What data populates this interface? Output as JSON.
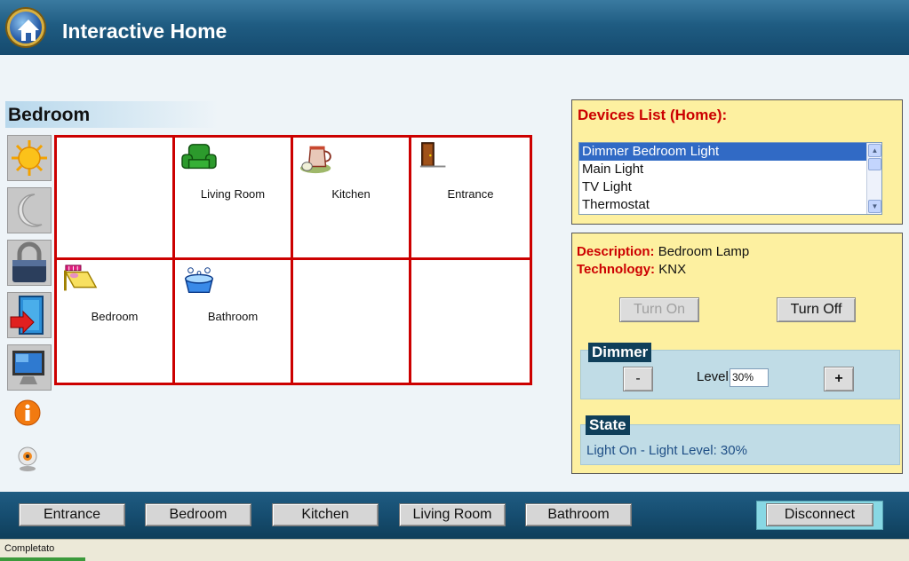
{
  "header": {
    "title": "Interactive Home"
  },
  "room": {
    "title": "Bedroom"
  },
  "side_icons": [
    "sun-icon",
    "moon-icon",
    "padlock-icon",
    "exit-door-icon",
    "monitor-icon",
    "info-icon",
    "webcam-icon"
  ],
  "grid": {
    "rooms": [
      {
        "label": "",
        "icon": ""
      },
      {
        "label": "Living Room",
        "icon": "armchair-icon"
      },
      {
        "label": "Kitchen",
        "icon": "pitcher-icon"
      },
      {
        "label": "Entrance",
        "icon": "door-icon"
      },
      {
        "label": "Bedroom",
        "icon": "bed-icon"
      },
      {
        "label": "Bathroom",
        "icon": "bathtub-icon"
      },
      {
        "label": "",
        "icon": ""
      },
      {
        "label": "",
        "icon": ""
      }
    ]
  },
  "devices": {
    "title": "Devices List (Home):",
    "items": [
      "Dimmer Bedroom Light",
      "Main Light",
      "TV Light",
      "Thermostat"
    ],
    "selected": "Dimmer Bedroom Light"
  },
  "detail": {
    "description_label": "Description:",
    "description_value": "Bedroom Lamp",
    "technology_label": "Technology:",
    "technology_value": "KNX",
    "turn_on": "Turn On",
    "turn_off": "Turn Off",
    "dimmer_title": "Dimmer",
    "minus": "-",
    "plus": "+",
    "level_label": "Level:",
    "level_value": "30%",
    "state_title": "State",
    "state_text": "Light On - Light Level: 30%"
  },
  "footer": {
    "buttons": [
      "Entrance",
      "Bedroom",
      "Kitchen",
      "Living Room",
      "Bathroom"
    ],
    "disconnect": "Disconnect"
  },
  "status": {
    "text": "Completato"
  },
  "colors": {
    "accent_red": "#cc0000",
    "header_blue": "#1f5c82",
    "panel_yellow": "#fdf0a0",
    "selection_blue": "#316ac5"
  }
}
